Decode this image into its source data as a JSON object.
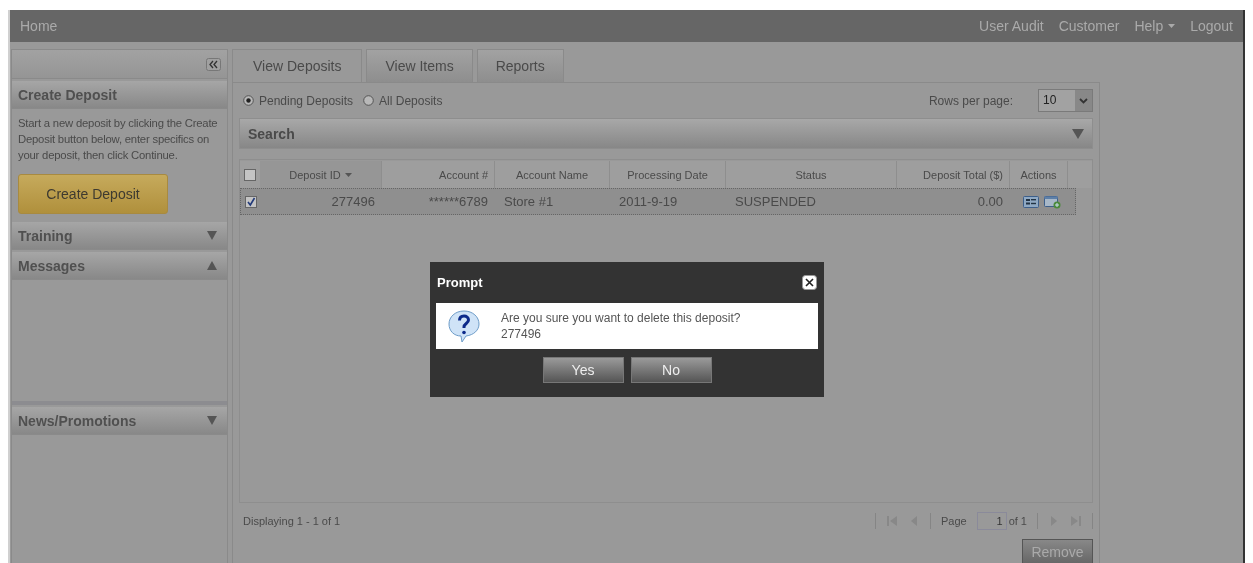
{
  "nav": {
    "home": "Home",
    "links": [
      {
        "label": "User Audit",
        "dropdown": false
      },
      {
        "label": "Customer",
        "dropdown": false
      },
      {
        "label": "Help",
        "dropdown": true
      },
      {
        "label": "Logout",
        "dropdown": false
      }
    ]
  },
  "sidebar": {
    "sections": [
      {
        "kind": "action",
        "title": "Create Deposit",
        "text": "Start a new deposit by clicking the Create Deposit button below, enter specifics on your deposit, then click Continue.",
        "button": "Create Deposit"
      },
      {
        "kind": "panel",
        "title": "Training",
        "expanded": false
      },
      {
        "kind": "panel",
        "title": "Messages",
        "expanded": true
      },
      {
        "kind": "panel",
        "title": "News/Promotions",
        "expanded": false
      }
    ]
  },
  "tabs": [
    {
      "label": "View Deposits",
      "selected": true
    },
    {
      "label": "View Items",
      "selected": false
    },
    {
      "label": "Reports",
      "selected": false
    }
  ],
  "filter": [
    {
      "label": "Pending Deposits",
      "selected": true
    },
    {
      "label": "All Deposits",
      "selected": false
    }
  ],
  "rows_per_page": {
    "label": "Rows per page:",
    "value": "10"
  },
  "search": {
    "title": "Search",
    "expanded": false
  },
  "table": {
    "select_all": false,
    "columns": [
      {
        "label": "Deposit ID",
        "sorted": true
      },
      {
        "label": "Account #",
        "sorted": false
      },
      {
        "label": "Account Name",
        "sorted": false
      },
      {
        "label": "Processing Date",
        "sorted": false
      },
      {
        "label": "Status",
        "sorted": false
      },
      {
        "label": "Deposit Total ($)",
        "sorted": false
      },
      {
        "label": "Actions",
        "sorted": false
      }
    ],
    "rows": [
      {
        "checked": true,
        "cells": [
          "277496",
          "******6789",
          "Store #1",
          "2011-9-19",
          "SUSPENDED",
          "0.00"
        ]
      }
    ]
  },
  "footer": {
    "displaying": "Displaying 1 - 1 of 1",
    "page_label": "Page",
    "page": "1",
    "page_count": "of 1",
    "remove": "Remove"
  },
  "dialog": {
    "title": "Prompt",
    "message": "Are you sure you want to delete this deposit?",
    "detail": "277496",
    "buttons": [
      "Yes",
      "No"
    ]
  }
}
